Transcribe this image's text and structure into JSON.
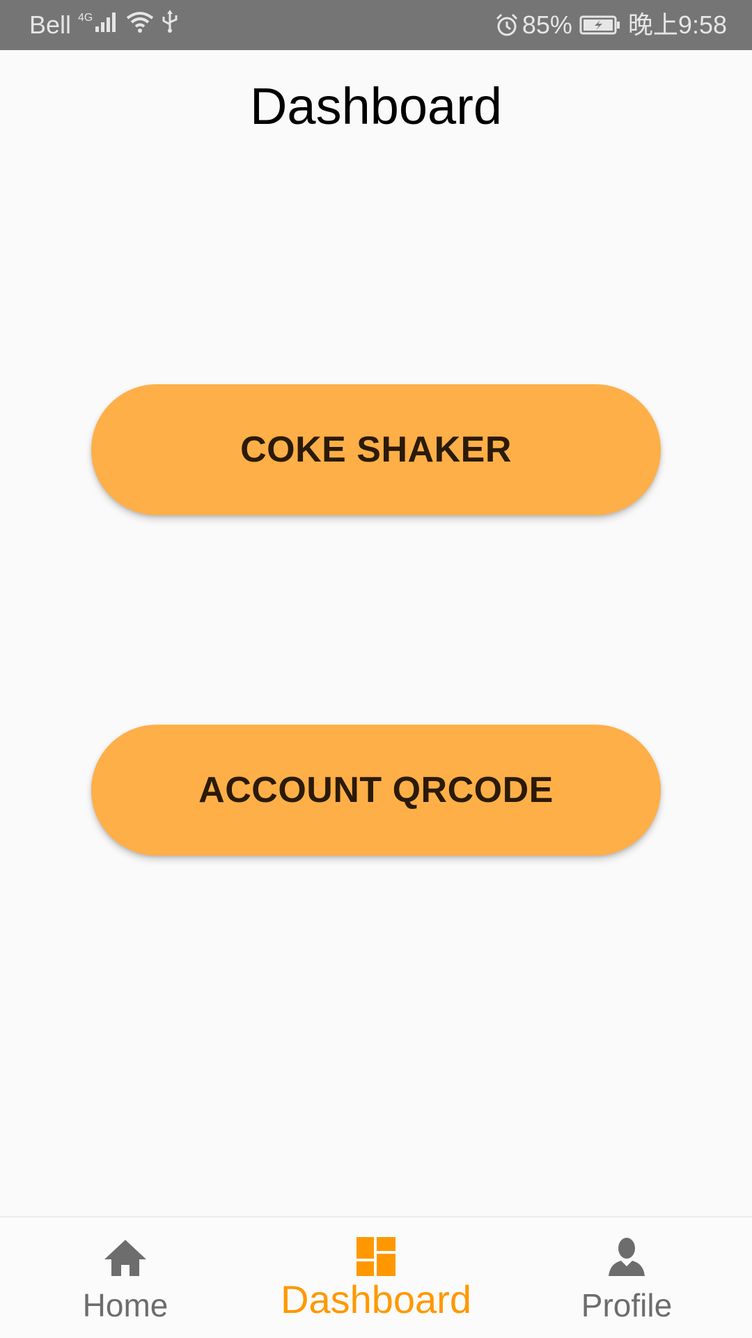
{
  "status_bar": {
    "carrier": "Bell",
    "network_type": "4G",
    "battery_percent": "85%",
    "time": "晚上9:58"
  },
  "header": {
    "title": "Dashboard"
  },
  "main": {
    "buttons": [
      {
        "label": "COKE SHAKER"
      },
      {
        "label": "ACCOUNT QRCODE"
      }
    ]
  },
  "bottom_nav": {
    "items": [
      {
        "label": "Home",
        "icon": "home-icon",
        "active": false
      },
      {
        "label": "Dashboard",
        "icon": "dashboard-icon",
        "active": true
      },
      {
        "label": "Profile",
        "icon": "person-icon",
        "active": false
      }
    ]
  },
  "colors": {
    "status_bar": "#757575",
    "background": "#fafafa",
    "button": "#ffaf47",
    "button_text": "#2a1a07",
    "accent_active": "#ff9800",
    "nav_inactive": "#6d6d6d"
  }
}
